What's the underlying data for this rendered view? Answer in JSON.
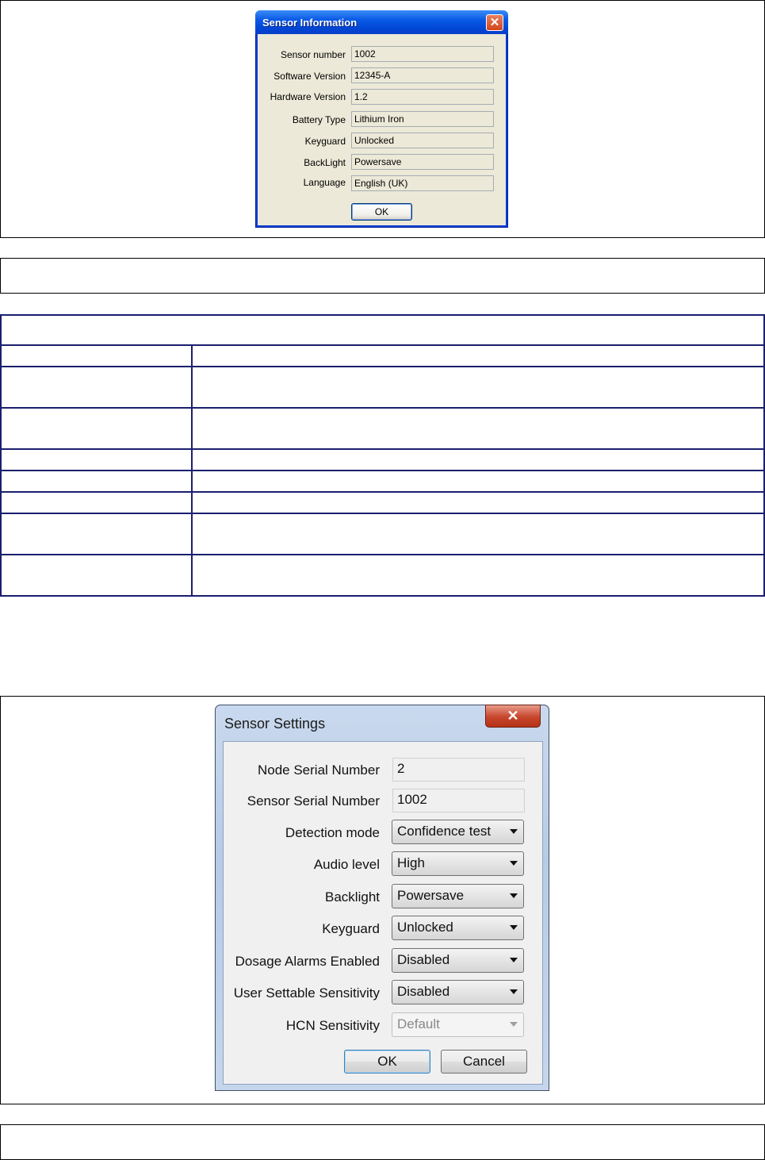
{
  "sensor_information": {
    "title": "Sensor Information",
    "close_glyph": "✕",
    "fields": [
      {
        "label": "Sensor number",
        "value": "1002"
      },
      {
        "label": "Software Version",
        "value": "12345-A"
      },
      {
        "label": "Hardware Version",
        "value": "1.2"
      },
      {
        "label": "Battery Type",
        "value": "Lithium Iron"
      },
      {
        "label": "Keyguard",
        "value": "Unlocked"
      },
      {
        "label": "BackLight",
        "value": "Powersave"
      },
      {
        "label": "Language",
        "value": "English (UK)"
      }
    ],
    "ok_label": "OK"
  },
  "sensor_settings": {
    "title": "Sensor Settings",
    "close_glyph": "✕",
    "fields": [
      {
        "label": "Node Serial Number",
        "value": "2"
      },
      {
        "label": "Sensor Serial Number",
        "value": "1002"
      }
    ],
    "dropdowns": [
      {
        "label": "Detection mode",
        "value": "Confidence test"
      },
      {
        "label": "Audio level",
        "value": "High"
      },
      {
        "label": "Backlight",
        "value": "Powersave"
      },
      {
        "label": "Keyguard",
        "value": "Unlocked"
      },
      {
        "label": "Dosage Alarms Enabled",
        "value": "Disabled"
      },
      {
        "label": "User Settable Sensitivity",
        "value": "Disabled"
      },
      {
        "label": "HCN Sensitivity",
        "value": "Default",
        "disabled": true
      }
    ],
    "ok_label": "OK",
    "cancel_label": "Cancel"
  }
}
